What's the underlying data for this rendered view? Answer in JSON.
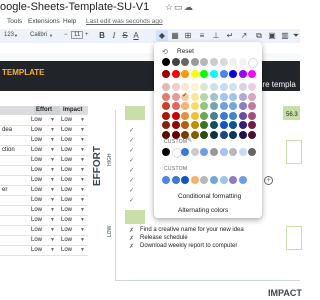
{
  "doc": {
    "title": "oogle-Sheets-Template-SU-V1"
  },
  "menu": {
    "items": [
      "Tools",
      "Extensions",
      "Help"
    ],
    "last_edit": "Last edit was seconds ago"
  },
  "toolbar": {
    "zoom": "123",
    "font": "Calibri",
    "font_size": "11"
  },
  "banner": {
    "left_text": "TEMPLATE",
    "right_text": "ore templa"
  },
  "table": {
    "headers": [
      "Effort",
      "Impact"
    ],
    "rows": [
      {
        "label": "",
        "effort": "Low",
        "impact": "Low"
      },
      {
        "label": "dea",
        "effort": "Low",
        "impact": "Low"
      },
      {
        "label": "",
        "effort": "Low",
        "impact": "Low"
      },
      {
        "label": "ction",
        "effort": "Low",
        "impact": "Low"
      },
      {
        "label": "",
        "effort": "Low",
        "impact": "Low"
      },
      {
        "label": "",
        "effort": "Low",
        "impact": "Low"
      },
      {
        "label": "",
        "effort": "Low",
        "impact": "Low"
      },
      {
        "label": "er",
        "effort": "Low",
        "impact": "Low"
      },
      {
        "label": "",
        "effort": "Low",
        "impact": "Low"
      },
      {
        "label": "",
        "effort": "Low",
        "impact": "Low"
      },
      {
        "label": "",
        "effort": "Low",
        "impact": "Low"
      },
      {
        "label": "",
        "effort": "Low",
        "impact": "Low"
      },
      {
        "label": "",
        "effort": "Low",
        "impact": "Low"
      },
      {
        "label": "",
        "effort": "Low",
        "impact": "Low"
      }
    ]
  },
  "chart": {
    "effort_label": "EFFORT",
    "high_label": "HIGH",
    "low_label": "LOW",
    "impact_label": "IMPACT",
    "right_value": "56.3",
    "tasks": [
      {
        "mark": "✗",
        "text": "Find a creative name for your new idea"
      },
      {
        "mark": "✗",
        "text": "Release schedule"
      },
      {
        "mark": "✗",
        "text": "Download weekly report to computer"
      }
    ]
  },
  "picker": {
    "reset_label": "Reset",
    "custom_label": "CUSTOM",
    "custom_label_2": "CUSTOM",
    "conditional_formatting": "Conditional formatting",
    "alternating_colors": "Alternating colors",
    "grays": [
      "#000000",
      "#434343",
      "#666666",
      "#999999",
      "#b7b7b7",
      "#cccccc",
      "#d9d9d9",
      "#efefef",
      "#f3f3f3",
      "#ffffff"
    ],
    "brights": [
      "#980000",
      "#ff0000",
      "#ff9900",
      "#ffff00",
      "#00ff00",
      "#00ffff",
      "#4a86e8",
      "#0000ff",
      "#9900ff",
      "#ff00ff"
    ],
    "pastels": [
      [
        "#e6b8af",
        "#f4cccc",
        "#fce5cd",
        "#fff2cc",
        "#d9ead3",
        "#d0e0e3",
        "#c9daf8",
        "#cfe2f3",
        "#d9d2e9",
        "#ead1dc"
      ],
      [
        "#dd7e6b",
        "#ea9999",
        "#f9cb9c",
        "#ffe599",
        "#b6d7a8",
        "#a2c4c9",
        "#a4c2f4",
        "#9fc5e8",
        "#b4a7d6",
        "#d5a6bd"
      ],
      [
        "#cc4125",
        "#e06666",
        "#f6b26b",
        "#ffd966",
        "#93c47d",
        "#76a5af",
        "#6d9eeb",
        "#6fa8dc",
        "#8e7cc3",
        "#c27ba0"
      ],
      [
        "#a61c00",
        "#cc0000",
        "#e69138",
        "#f1c232",
        "#6aa84f",
        "#45818e",
        "#3c78d8",
        "#3d85c6",
        "#674ea7",
        "#a64d79"
      ],
      [
        "#85200c",
        "#990000",
        "#b45f06",
        "#bf9000",
        "#38761d",
        "#134f5c",
        "#1155cc",
        "#0b5394",
        "#351c75",
        "#741b47"
      ],
      [
        "#5b0f00",
        "#660000",
        "#783f04",
        "#7f6000",
        "#274e13",
        "#0c343d",
        "#1c4587",
        "#073763",
        "#20124d",
        "#4c1130"
      ]
    ],
    "custom_row_1": [
      "#000000",
      "#ffffff",
      "#3c78d8",
      "#cccccc",
      "#6d9eeb",
      "#999999",
      "#a4c2f4",
      "#b7b7b7",
      "#c9daf8",
      "#666666"
    ],
    "custom_row_2": [
      "#4a86e8",
      "#3c78d8",
      "#1155cc",
      "#f6b26b",
      "#b7b7b7",
      "#6fa8dc",
      "#9fc5e8",
      "#8e7cc3",
      "#6d9eeb"
    ],
    "selected_index": 32
  }
}
